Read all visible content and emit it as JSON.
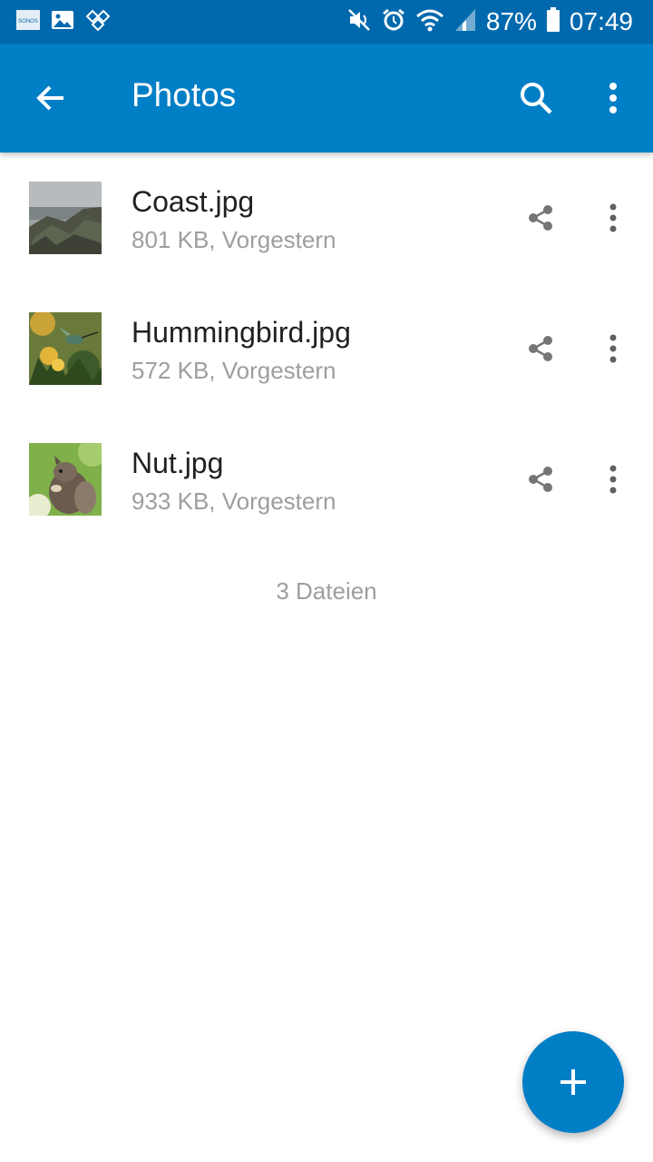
{
  "status_bar": {
    "battery": "87%",
    "time": "07:49",
    "icons": [
      "sonos-icon",
      "image-icon",
      "puzzle-icon",
      "mute-icon",
      "alarm-icon",
      "wifi-icon",
      "signal-icon",
      "battery-icon"
    ],
    "sonos_label": "SONOS"
  },
  "app_bar": {
    "title": "Photos",
    "back_icon": "arrow-left-icon",
    "search_icon": "search-icon",
    "more_icon": "more-vertical-icon",
    "color": "#007ec6"
  },
  "files": [
    {
      "name": "Coast.jpg",
      "meta": "801 KB, Vorgestern",
      "thumbnail": "coast-photo"
    },
    {
      "name": "Hummingbird.jpg",
      "meta": "572 KB, Vorgestern",
      "thumbnail": "hummingbird-photo"
    },
    {
      "name": "Nut.jpg",
      "meta": "933 KB, Vorgestern",
      "thumbnail": "squirrel-photo"
    }
  ],
  "footer": {
    "count": "3 Dateien"
  },
  "fab": {
    "icon": "plus-icon",
    "color": "#007ec6"
  }
}
